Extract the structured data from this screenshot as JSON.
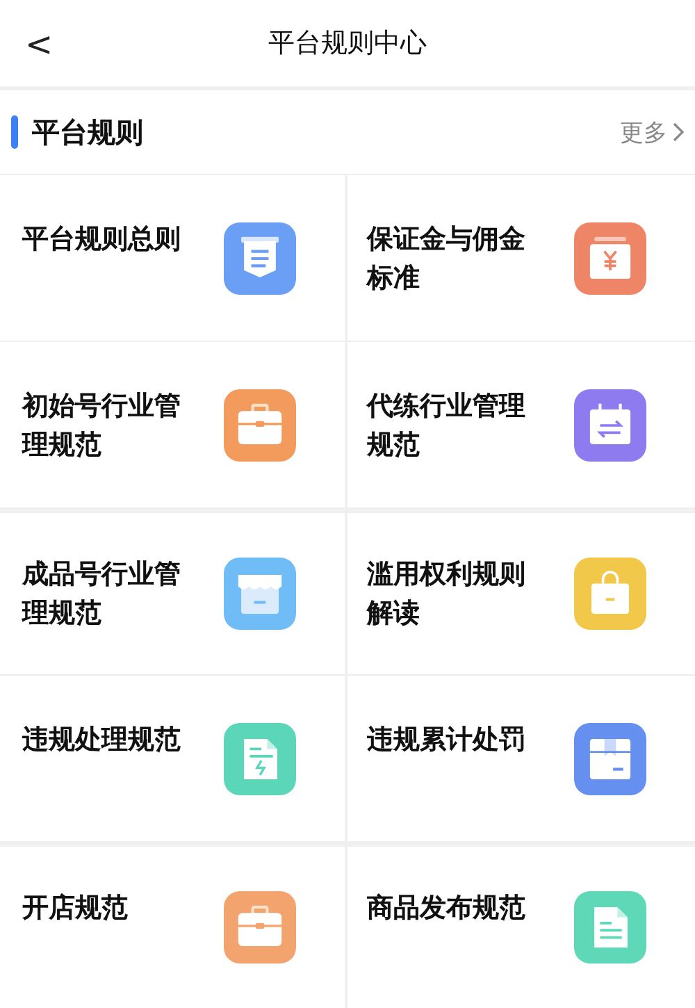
{
  "header": {
    "back": "<",
    "title": "平台规则中心"
  },
  "section": {
    "title": "平台规则",
    "more": "更多"
  },
  "rules": [
    {
      "label": "平台规则总则",
      "kind": "banner",
      "color": "#6b9ef5"
    },
    {
      "label": "保证金与佣金标准",
      "kind": "yuan",
      "color": "#ee8566"
    },
    {
      "label": "初始号行业管理规范",
      "kind": "briefcase",
      "color": "#f29b5c"
    },
    {
      "label": "代练行业管理规范",
      "kind": "calendar",
      "color": "#8f7bf0"
    },
    {
      "label": "成品号行业管理规范",
      "kind": "store",
      "color": "#6fbcf7"
    },
    {
      "label": "滥用权利规则解读",
      "kind": "bag",
      "color": "#f2c84a"
    },
    {
      "label": "违规处理规范",
      "kind": "bolt-doc",
      "color": "#5bd6b8"
    },
    {
      "label": "违规累计处罚",
      "kind": "package",
      "color": "#6590f0"
    },
    {
      "label": "开店规范",
      "kind": "briefcase",
      "color": "#f2a36e"
    },
    {
      "label": "商品发布规范",
      "kind": "doc",
      "color": "#5fd8b8"
    }
  ]
}
